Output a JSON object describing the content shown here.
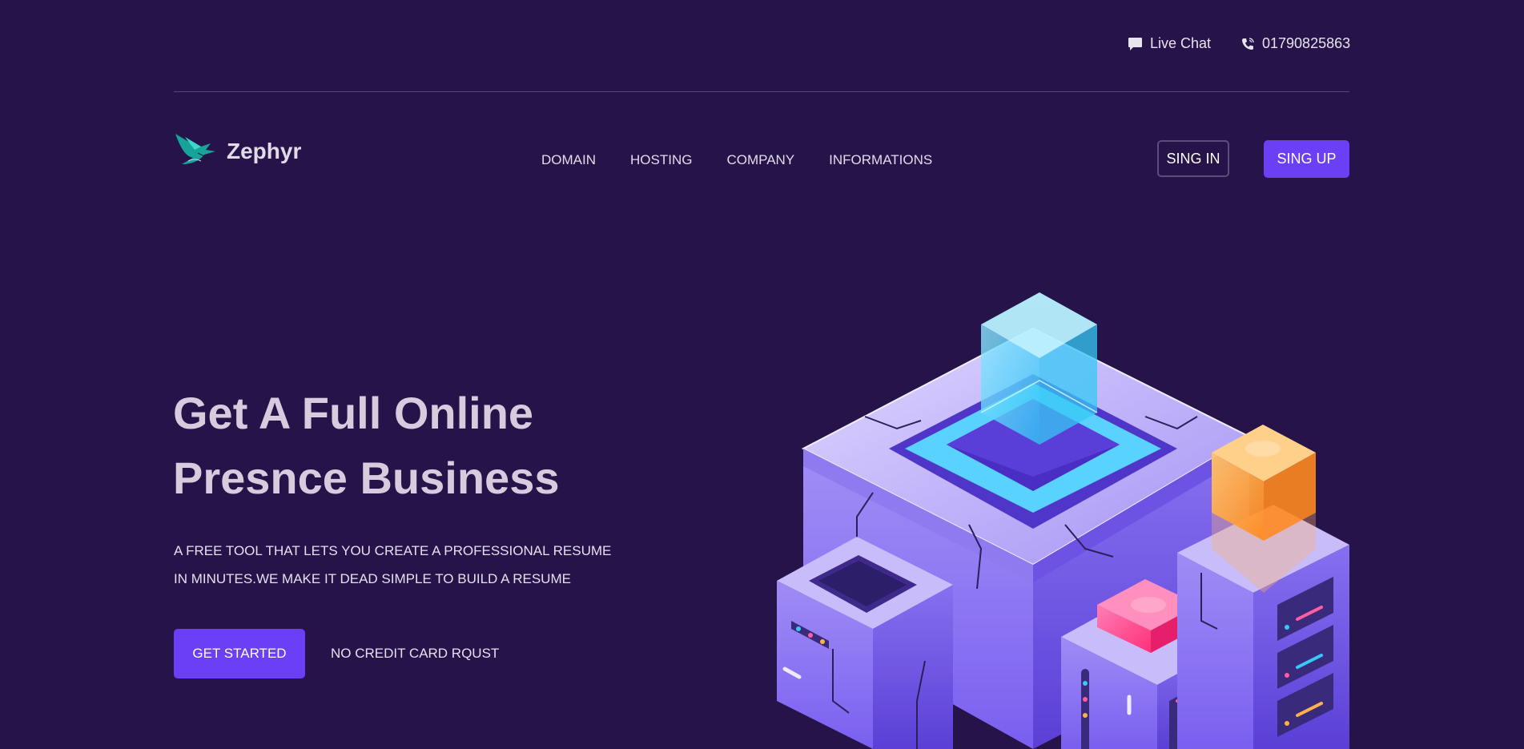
{
  "topbar": {
    "live_chat": "Live Chat",
    "phone": "01790825863"
  },
  "brand": {
    "name": "Zephyr",
    "logo_icon": "hummingbird-logo"
  },
  "nav": {
    "items": [
      "DOMAIN",
      "HOSTING",
      "COMPANY",
      "INFORMATIONS"
    ]
  },
  "auth": {
    "sign_in": "SING IN",
    "sign_up": "SING UP"
  },
  "hero": {
    "title_line1": "Get A Full Online",
    "title_line2": "Presnce Business",
    "desc_line1": "A FREE TOOL THAT LETS YOU CREATE A PROFESSIONAL RESUME",
    "desc_line2": "IN MINUTES.WE MAKE IT DEAD SIMPLE TO BUILD A RESUME",
    "cta": "GET STARTED",
    "note": "NO CREDIT CARD RQUST"
  },
  "colors": {
    "background": "#25134a",
    "accent": "#6a3ff5"
  }
}
